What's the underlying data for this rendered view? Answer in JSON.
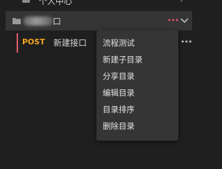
{
  "tree": {
    "top_item": {
      "label": "个人中心",
      "icon": "folder-icon",
      "chevron": "›"
    },
    "folder": {
      "name_suffix": "口",
      "more": "•••",
      "more_color": "#e0556a",
      "icon": "folder-icon",
      "toggle_icon": "chevron-down-icon"
    },
    "api": {
      "method": "POST",
      "method_color": "#f5a623",
      "name": "新建接口",
      "accent_color": "#e35d6a",
      "more": "•••"
    }
  },
  "context_menu": {
    "items": [
      {
        "label": "流程测试"
      },
      {
        "label": "新建子目录"
      },
      {
        "label": "分享目录"
      },
      {
        "label": "编辑目录"
      },
      {
        "label": "目录排序"
      },
      {
        "label": "删除目录"
      }
    ]
  }
}
